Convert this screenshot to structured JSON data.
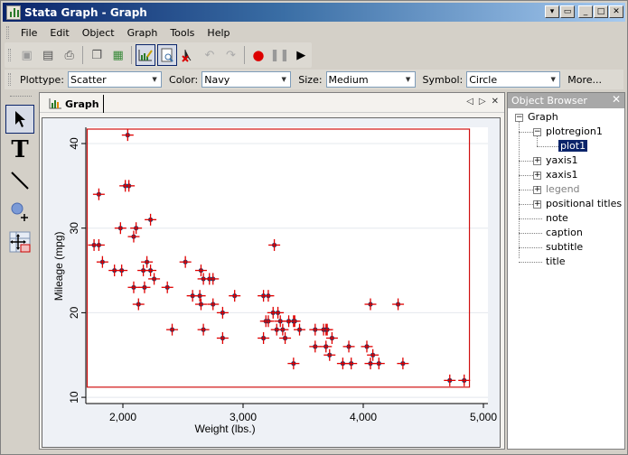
{
  "window": {
    "title": "Stata Graph - Graph",
    "controls": [
      "menu-dropdown",
      "restore",
      "minimize",
      "maximize",
      "close"
    ]
  },
  "menubar": {
    "items": [
      "File",
      "Edit",
      "Object",
      "Graph",
      "Tools",
      "Help"
    ]
  },
  "toolbar": {
    "buttons": [
      {
        "name": "open-icon",
        "glyph": "▣"
      },
      {
        "name": "save-icon",
        "glyph": "▤"
      },
      {
        "name": "print-icon",
        "glyph": "⎙"
      },
      {
        "name": "copy-icon",
        "glyph": "❐"
      },
      {
        "name": "rename-icon",
        "glyph": "▦"
      },
      {
        "name": "graph-editor-icon",
        "glyph": "📈",
        "active": true
      },
      {
        "name": "object-browser-icon",
        "glyph": "🔍",
        "active": true
      },
      {
        "name": "pointer-delete-icon",
        "glyph": "✗"
      },
      {
        "name": "undo-icon",
        "glyph": "↶"
      },
      {
        "name": "redo-icon",
        "glyph": "↷"
      },
      {
        "name": "record-icon",
        "glyph": "●"
      },
      {
        "name": "pause-icon",
        "glyph": "❚❚"
      },
      {
        "name": "play-icon",
        "glyph": "▶"
      }
    ]
  },
  "propbar": {
    "plottype_label": "Plottype:",
    "plottype_value": "Scatter",
    "color_label": "Color:",
    "color_value": "Navy",
    "size_label": "Size:",
    "size_value": "Medium",
    "symbol_label": "Symbol:",
    "symbol_value": "Circle",
    "more_label": "More..."
  },
  "tools": [
    "pointer",
    "text",
    "line",
    "marker",
    "grid-edit"
  ],
  "graph_tab": {
    "label": "Graph"
  },
  "object_browser": {
    "title": "Object Browser",
    "nodes": [
      {
        "label": "Graph",
        "level": 0,
        "toggle": "-"
      },
      {
        "label": "plotregion1",
        "level": 1,
        "toggle": "-"
      },
      {
        "label": "plot1",
        "level": 2,
        "selected": true
      },
      {
        "label": "yaxis1",
        "level": 1,
        "toggle": "+"
      },
      {
        "label": "xaxis1",
        "level": 1,
        "toggle": "+"
      },
      {
        "label": "legend",
        "level": 1,
        "toggle": "+",
        "dim": true
      },
      {
        "label": "positional titles",
        "level": 1,
        "toggle": "+"
      },
      {
        "label": "note",
        "level": 1
      },
      {
        "label": "caption",
        "level": 1
      },
      {
        "label": "subtitle",
        "level": 1
      },
      {
        "label": "title",
        "level": 1
      }
    ]
  },
  "colors": {
    "marker_fill": "#1a3a6b",
    "marker_cross": "#e00000",
    "selection_box": "#d01010",
    "plot_bg": "#ffffff",
    "graph_bg": "#eef1f6"
  },
  "chart_data": {
    "type": "scatter",
    "title": "",
    "xlabel": "Weight (lbs.)",
    "ylabel": "Mileage (mpg)",
    "xlim": [
      1700,
      5000
    ],
    "ylim": [
      11,
      41.5
    ],
    "xticks": [
      2000,
      3000,
      4000,
      5000
    ],
    "xtick_labels": [
      "2,000",
      "3,000",
      "4,000",
      "5,000"
    ],
    "yticks": [
      10,
      20,
      30,
      40
    ],
    "ytick_labels": [
      "10",
      "20",
      "30",
      "40"
    ],
    "grid": true,
    "legend": "none",
    "series": [
      {
        "name": "plot1",
        "points": [
          [
            2040,
            41
          ],
          [
            2020,
            35
          ],
          [
            2050,
            35
          ],
          [
            1800,
            34
          ],
          [
            1760,
            28
          ],
          [
            1800,
            28
          ],
          [
            1980,
            30
          ],
          [
            2110,
            30
          ],
          [
            2230,
            31
          ],
          [
            2090,
            29
          ],
          [
            1830,
            26
          ],
          [
            2200,
            26
          ],
          [
            2520,
            26
          ],
          [
            3260,
            28
          ],
          [
            1930,
            25
          ],
          [
            1990,
            25
          ],
          [
            2170,
            25
          ],
          [
            2230,
            25
          ],
          [
            2260,
            24
          ],
          [
            2650,
            25
          ],
          [
            2670,
            24
          ],
          [
            2720,
            24
          ],
          [
            2750,
            24
          ],
          [
            2090,
            23
          ],
          [
            2180,
            23
          ],
          [
            2370,
            23
          ],
          [
            2580,
            22
          ],
          [
            2640,
            22
          ],
          [
            2930,
            22
          ],
          [
            3170,
            22
          ],
          [
            3210,
            22
          ],
          [
            2130,
            21
          ],
          [
            2650,
            21
          ],
          [
            2750,
            21
          ],
          [
            2830,
            20
          ],
          [
            3250,
            20
          ],
          [
            3290,
            20
          ],
          [
            3190,
            19
          ],
          [
            3210,
            19
          ],
          [
            3310,
            19
          ],
          [
            3380,
            19
          ],
          [
            3420,
            19
          ],
          [
            3430,
            19
          ],
          [
            3280,
            18
          ],
          [
            3330,
            18
          ],
          [
            3470,
            18
          ],
          [
            3600,
            18
          ],
          [
            3670,
            18
          ],
          [
            3690,
            18
          ],
          [
            3700,
            18
          ],
          [
            3740,
            17
          ],
          [
            2410,
            18
          ],
          [
            2670,
            18
          ],
          [
            2830,
            17
          ],
          [
            3170,
            17
          ],
          [
            3350,
            17
          ],
          [
            3600,
            16
          ],
          [
            3690,
            16
          ],
          [
            3880,
            16
          ],
          [
            4030,
            16
          ],
          [
            3720,
            15
          ],
          [
            4080,
            15
          ],
          [
            3420,
            14
          ],
          [
            3830,
            14
          ],
          [
            3900,
            14
          ],
          [
            4060,
            14
          ],
          [
            4130,
            14
          ],
          [
            4330,
            14
          ],
          [
            4060,
            21
          ],
          [
            4290,
            21
          ],
          [
            4720,
            12
          ],
          [
            4840,
            12
          ]
        ]
      }
    ]
  }
}
